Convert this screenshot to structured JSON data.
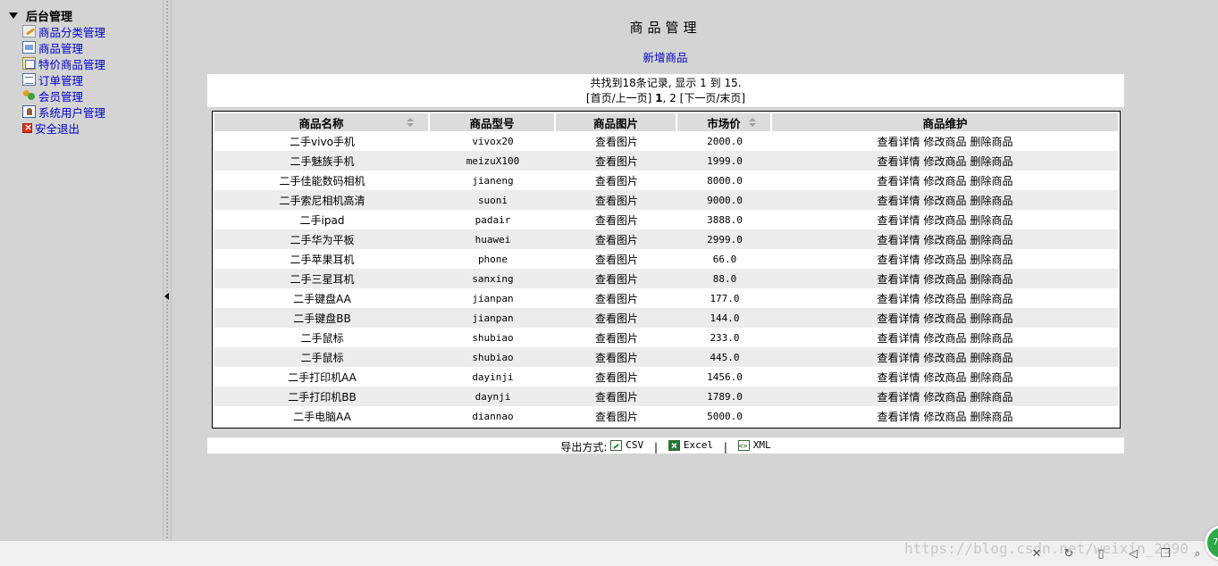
{
  "sidebar": {
    "root": "后台管理",
    "items": [
      {
        "label": "商品分类管理",
        "icon": "pencil-icon"
      },
      {
        "label": "商品管理",
        "icon": "box-icon"
      },
      {
        "label": "特价商品管理",
        "icon": "tag-icon"
      },
      {
        "label": "订单管理",
        "icon": "list-icon"
      },
      {
        "label": "会员管理",
        "icon": "users-icon"
      },
      {
        "label": "系统用户管理",
        "icon": "sysuser-icon"
      },
      {
        "label": "安全退出",
        "icon": "exit-icon"
      }
    ]
  },
  "main": {
    "title": "商品管理",
    "add_link": "新增商品",
    "summary": "共找到18条记录, 显示 1 到 15.",
    "pager": {
      "open": "[",
      "first": "首页",
      "slash1": "/",
      "prev": "上一页",
      "close1": "]",
      "page1": "1",
      "comma": ",",
      "page2": "2",
      "open2": "[",
      "next": "下一页",
      "slash2": "/",
      "last": "末页",
      "close2": "]"
    },
    "table": {
      "headers": [
        "商品名称",
        "商品型号",
        "商品图片",
        "市场价",
        "商品维护"
      ],
      "view_image": "查看图片",
      "op_detail": "查看详情",
      "op_edit": "修改商品",
      "op_delete": "删除商品",
      "rows": [
        {
          "name": "二手vivo手机",
          "model": "vivox20",
          "price": "2000.0"
        },
        {
          "name": "二手魅族手机",
          "model": "meizuX100",
          "price": "1999.0"
        },
        {
          "name": "二手佳能数码相机",
          "model": "jianeng",
          "price": "8000.0"
        },
        {
          "name": "二手索尼相机高清",
          "model": "suoni",
          "price": "9000.0"
        },
        {
          "name": "二手ipad",
          "model": "padair",
          "price": "3888.0"
        },
        {
          "name": "二手华为平板",
          "model": "huawei",
          "price": "2999.0"
        },
        {
          "name": "二手苹果耳机",
          "model": "phone",
          "price": "66.0"
        },
        {
          "name": "二手三星耳机",
          "model": "sanxing",
          "price": "88.0"
        },
        {
          "name": "二手键盘AA",
          "model": "jianpan",
          "price": "177.0"
        },
        {
          "name": "二手键盘BB",
          "model": "jianpan",
          "price": "144.0"
        },
        {
          "name": "二手鼠标",
          "model": "shubiao",
          "price": "233.0"
        },
        {
          "name": "二手鼠标",
          "model": "shubiao",
          "price": "445.0"
        },
        {
          "name": "二手打印机AA",
          "model": "dayinji",
          "price": "1456.0"
        },
        {
          "name": "二手打印机BB",
          "model": "daynji",
          "price": "1789.0"
        },
        {
          "name": "二手电脑AA",
          "model": "diannao",
          "price": "5000.0"
        }
      ]
    },
    "export": {
      "label": "导出方式:",
      "csv": "CSV",
      "excel": "Excel",
      "xml": "XML",
      "separator": "|"
    }
  },
  "bottombar": {
    "watermark": "https://blog.csdn.net/weixin_2990",
    "badge": "79"
  }
}
